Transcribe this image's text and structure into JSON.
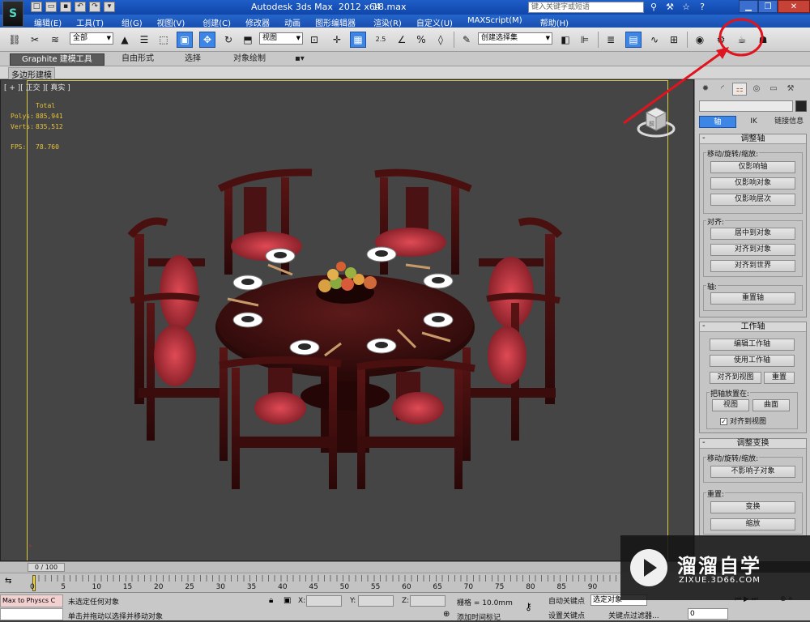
{
  "app": {
    "logo": "S",
    "title": "Autodesk 3ds Max  2012 x64",
    "file": "18.max",
    "search_placeholder": "键入关键字或短语",
    "title_icons": [
      "binoculars-icon",
      "star-icon",
      "help-icon"
    ]
  },
  "menu": [
    {
      "label": "编辑(E)"
    },
    {
      "label": "工具(T)"
    },
    {
      "label": "组(G)"
    },
    {
      "label": "视图(V)"
    },
    {
      "label": "创建(C)"
    },
    {
      "label": "修改器"
    },
    {
      "label": "动画"
    },
    {
      "label": "图形编辑器"
    },
    {
      "label": "渲染(R)"
    },
    {
      "label": "自定义(U)"
    },
    {
      "label": "MAXScript(M)"
    },
    {
      "label": "帮助(H)"
    }
  ],
  "toolbar": {
    "selection_filter": "全部",
    "ref_coord": "视图",
    "snap_angle": "2.5",
    "named_selection": "创建选择集"
  },
  "ribbon": {
    "tabs": [
      {
        "label": "Graphite 建模工具"
      },
      {
        "label": "自由形式"
      },
      {
        "label": "选择"
      },
      {
        "label": "对象绘制"
      }
    ],
    "panel_label": "多边形建模"
  },
  "viewport": {
    "label": "[ + ][ 正交 ][ 真实 ]",
    "stats": {
      "header": "Total",
      "polys_label": "Polys:",
      "polys": "885,941",
      "verts_label": "Verts:",
      "verts": "835,512",
      "fps_label": "FPS:",
      "fps": "78.760"
    },
    "viewcube_text": "前"
  },
  "command_panel": {
    "subtabs": [
      {
        "label": "轴"
      },
      {
        "label": "IK"
      },
      {
        "label": "链接信息"
      }
    ],
    "adjust_pivot": {
      "title": "调整轴",
      "move_group": "移动/旋转/缩放:",
      "btn_pivot_only": "仅影响轴",
      "btn_object_only": "仅影响对象",
      "btn_hierarchy_only": "仅影响层次",
      "align_group": "对齐:",
      "btn_center": "居中到对象",
      "btn_align_obj": "对齐到对象",
      "btn_align_world": "对齐到世界",
      "pivot_group": "轴:",
      "btn_reset": "重置轴"
    },
    "working_pivot": {
      "title": "工作轴",
      "btn_edit": "编辑工作轴",
      "btn_use": "使用工作轴",
      "btn_align_view": "对齐到视图",
      "btn_reset": "重置",
      "place_group": "把轴放置在:",
      "btn_view": "视图",
      "btn_surface": "曲面",
      "chk_align_view": "对齐到视图"
    },
    "adjust_transform": {
      "title": "调整变换",
      "move_group": "移动/旋转/缩放:",
      "btn_dont_affect": "不影响子对象",
      "reset_group": "重置:",
      "btn_transform": "变换",
      "btn_scale": "缩放"
    }
  },
  "timeline": {
    "slider": "0 / 100",
    "ticks": [
      "0",
      "5",
      "10",
      "15",
      "20",
      "25",
      "30",
      "35",
      "40",
      "45",
      "50",
      "55",
      "60",
      "65",
      "70",
      "75",
      "80",
      "85",
      "90"
    ]
  },
  "status": {
    "listener": "Max to Physcs C",
    "message": "未选定任何对象",
    "prompt": "单击并拖动以选择并移动对象",
    "x_label": "X:",
    "y_label": "Y:",
    "z_label": "Z:",
    "grid": "栅格 = 10.0mm",
    "add_time_tag": "添加时间标记",
    "auto_key": "自动关键点",
    "auto_key_value": "选定对象",
    "set_key": "设置关键点",
    "key_filters": "关键点过滤器...",
    "frame": "0"
  },
  "watermark": {
    "cn": "溜溜自学",
    "en": "ZIXUE.3D66.COM"
  },
  "colors": {
    "title_blue": "#1e5ec8",
    "active_blue": "#3e86e6",
    "viewport_bg": "#454545",
    "stats_yellow": "#e8c43a",
    "annotation_red": "#e0141e"
  }
}
